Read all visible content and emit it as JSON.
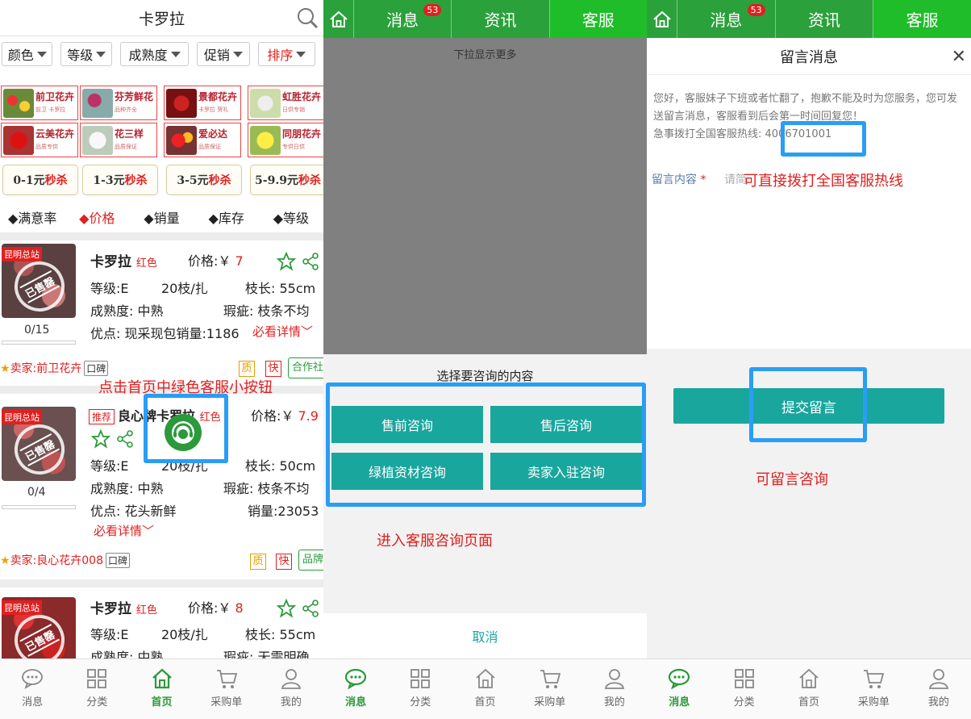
{
  "panel1": {
    "title": "卡罗拉",
    "filters": [
      "颜色",
      "等级",
      "成熟度",
      "促销",
      "排序"
    ],
    "banner": [
      {
        "name": "前卫花卉",
        "sub": "前卫 卡罗拉"
      },
      {
        "name": "芬芳鲜花",
        "sub": "品种齐全"
      },
      {
        "name": "景都花卉",
        "sub": "卡罗拉 贺礼"
      },
      {
        "name": "虹胜花卉",
        "sub": "日供专销"
      },
      {
        "name": "云美花卉",
        "sub": "品质专供"
      },
      {
        "name": "花三样",
        "sub": "品质保证"
      },
      {
        "name": "爱必达",
        "sub": "品质保证"
      },
      {
        "name": "同朋花卉",
        "sub": "专供日供"
      }
    ],
    "sale_tags": [
      {
        "range": "0-1元",
        "tag": "秒杀"
      },
      {
        "range": "1-3元",
        "tag": "秒杀"
      },
      {
        "range": "3-5元",
        "tag": "秒杀"
      },
      {
        "range": "5-9.9元",
        "tag": "秒杀"
      }
    ],
    "sort": [
      "◆满意率",
      "◆价格",
      "◆销量",
      "◆库存",
      "◆等级"
    ],
    "products": [
      {
        "station": "昆明总站",
        "stamp": "已售罄",
        "ratio": "0/15",
        "name": "卡罗拉",
        "color": "红色",
        "price_label": "价格:￥",
        "price": "7",
        "grade": "等级:E",
        "pack": "20枝/扎",
        "length": "枝长: 55cm",
        "maturity": "成熟度: 中熟",
        "defect": "瑕疵: 枝条不均",
        "merit": "优点: 现采现包销量:1186",
        "detail": "必看详情",
        "seller": "卖家:前卫花卉",
        "koubei": "口碑",
        "q": "质",
        "k": "快",
        "badge": "合作社"
      },
      {
        "station": "昆明总站",
        "stamp": "已售罄",
        "ratio": "0/4",
        "tag": "推荐",
        "name": "良心牌卡罗拉",
        "color": "红色",
        "price_label": "价格:￥",
        "price": "7.9",
        "grade": "等级:E",
        "pack": "20枝/扎",
        "length": "枝长: 50cm",
        "maturity": "成熟度: 中熟",
        "defect": "瑕疵: 枝条不均",
        "merit": "优点: 花头新鲜",
        "sales": "销量:23053",
        "detail": "必看详情",
        "seller": "卖家:良心花卉008",
        "koubei": "口碑",
        "q": "质",
        "k": "快",
        "badge": "品牌"
      },
      {
        "station": "昆明总站",
        "stamp": "已售罄",
        "name": "卡罗拉",
        "color": "红色",
        "price_label": "价格:￥",
        "price": "8",
        "grade": "等级:E",
        "pack": "20枝/扎",
        "length": "枝长: 55cm",
        "maturity": "成熟度: 中熟",
        "defect": "瑕疵: 无需明确"
      }
    ],
    "annotation": "点击首页中绿色客服小按钮"
  },
  "topnav": {
    "msg": "消息",
    "badge": "53",
    "news": "资讯",
    "service": "客服"
  },
  "panel2": {
    "pulldown": "下拉显示更多",
    "sheet_title": "选择要咨询的内容",
    "buttons": [
      "售前咨询",
      "售后咨询",
      "绿植资材咨询",
      "卖家入驻咨询"
    ],
    "cancel": "取消",
    "annotation": "进入客服咨询页面"
  },
  "panel3": {
    "header": "留言消息",
    "notice": "您好，客服妹子下班或者忙翻了，抱歉不能及时为您服务，您可发送留言消息，客服看到后会第一时间回复您！",
    "hotline_label": "急事拨打全国客服热线:",
    "hotline": "4006701001",
    "field_label": "留言内容",
    "field_star": "*",
    "placeholder": "请简",
    "submit": "提交留言",
    "annotation1": "可直接拨打全国客服热线",
    "annotation2": "可留言咨询"
  },
  "bottomnav": [
    "消息",
    "分类",
    "首页",
    "采购单",
    "我的"
  ],
  "colors": {
    "green": "#2ba13b",
    "teal": "#19a69d",
    "red": "#e02020",
    "blue": "#2a9df4"
  }
}
